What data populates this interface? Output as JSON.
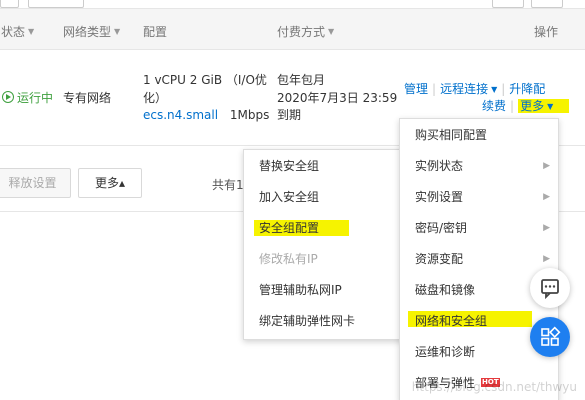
{
  "header": {
    "status": "状态",
    "network_type": "网络类型",
    "config": "配置",
    "payment": "付费方式",
    "ops": "操作"
  },
  "row": {
    "status": "运行中",
    "network": "专有网络",
    "config_line1": "1 vCPU 2 GiB （I/O优",
    "config_line2": "化）",
    "instance_type": "ecs.n4.small",
    "bandwidth": "1Mbps",
    "pay_line1": "包年包月",
    "pay_line2": "2020年7月3日 23:59",
    "pay_line3": "到期",
    "ops": {
      "manage": "管理",
      "remote": "远程连接",
      "upgrade": "升降配",
      "renew": "续费",
      "more": "更多"
    }
  },
  "footer": {
    "release": "释放设置",
    "more": "更多▴",
    "total": "共有1"
  },
  "menu_main": {
    "items": [
      "购买相同配置",
      "实例状态",
      "实例设置",
      "密码/密钥",
      "资源变配",
      "磁盘和镜像",
      "网络和安全组",
      "运维和诊断",
      "部署与弹性"
    ],
    "badge": "HOT"
  },
  "menu_sub": {
    "items": [
      "替换安全组",
      "加入安全组",
      "安全组配置",
      "修改私有IP",
      "管理辅助私网IP",
      "绑定辅助弹性网卡"
    ]
  },
  "watermark": "https://blog.csdn.net/thwyu",
  "colors": {
    "link": "#0070cc",
    "running": "#3fa03f",
    "highlight": "#f6f300",
    "fab_blue": "#1e7ff0"
  }
}
